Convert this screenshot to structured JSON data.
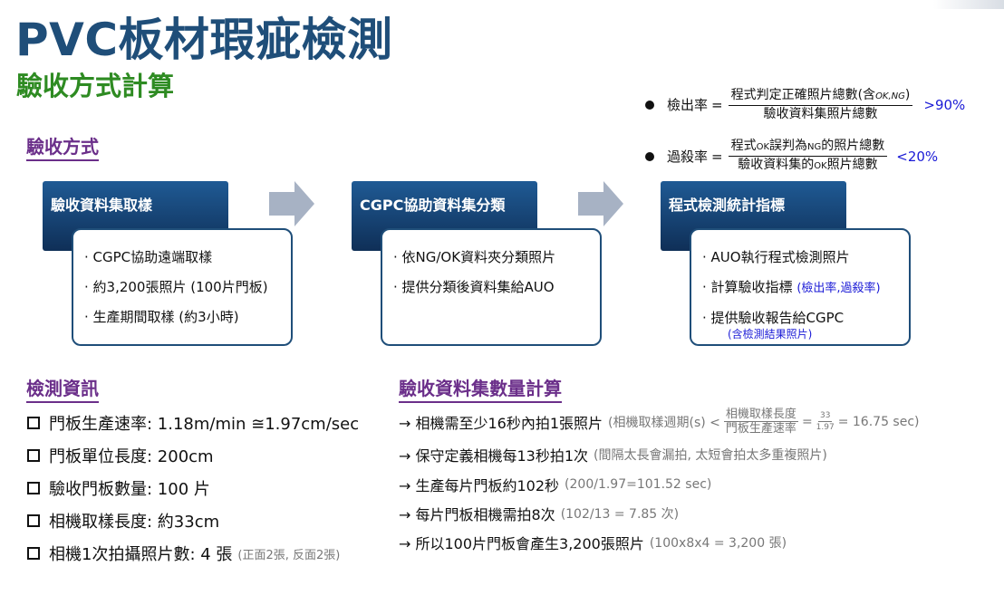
{
  "title": "PVC板材瑕疵檢測",
  "subtitle": "驗收方式計算",
  "method_heading": "驗收方式",
  "formulas": {
    "detect": {
      "label": "檢出率",
      "eq": "=",
      "numerator": "程式判定正確照片總數(含",
      "numerator_small": "OK,NG",
      "numerator_end": ")",
      "denominator": "驗收資料集照片總數",
      "target": ">90%"
    },
    "overkill": {
      "label": "過殺率",
      "eq": "=",
      "numerator_a": "程式",
      "numerator_small1": "OK",
      "numerator_b": "誤判為",
      "numerator_small2": "NG",
      "numerator_c": "的照片總數",
      "denominator_a": "驗收資料集的",
      "denominator_small": "OK",
      "denominator_b": "照片總數",
      "target": "<20%"
    }
  },
  "steps": [
    {
      "header": "驗收資料集取樣",
      "items": [
        "· CGPC協助遠端取樣",
        "· 約3,200張照片 (100片門板)",
        "· 生產期間取樣 (約3小時)"
      ]
    },
    {
      "header": "CGPC協助資料集分類",
      "items": [
        "· 依NG/OK資料夾分類照片",
        "· 提供分類後資料集給AUO"
      ]
    },
    {
      "header": "程式檢測統計指標",
      "items": [
        "· AUO執行程式檢測照片",
        "· 計算驗收指標",
        "· 提供驗收報告給CGPC"
      ],
      "item2_note": "(檢出率,過殺率)",
      "item3_note": "(含檢測結果照片)"
    }
  ],
  "info_heading": "檢測資訊",
  "info": [
    {
      "text": "門板生產速率: 1.18m/min ≅1.97cm/sec"
    },
    {
      "text": "門板單位長度: 200cm"
    },
    {
      "text": "驗收門板數量: 100 片"
    },
    {
      "text": "相機取樣長度: 約33cm"
    },
    {
      "text": "相機1次拍攝照片數: 4 張",
      "note": "(正面2張, 反面2張)"
    }
  ],
  "calc_heading": "驗收資料集數量計算",
  "calc": [
    {
      "text": "→ 相機需至少16秒內拍1張照片",
      "note_a": "(相機取樣週期(s) <",
      "frac_num": "相機取樣長度",
      "frac_den": "門板生產速率",
      "eq": "=",
      "mini_num": "33",
      "mini_den": "1.97",
      "note_b": "= 16.75 sec)"
    },
    {
      "text": "→ 保守定義相機每13秒拍1次",
      "note": "(間隔太長會漏拍, 太短會拍太多重複照片)"
    },
    {
      "text": "→ 生產每片門板約102秒",
      "note": "(200/1.97=101.52 sec)"
    },
    {
      "text": "→ 每片門板相機需拍8次",
      "note": "(102/13 = 7.85 次)"
    },
    {
      "text": "→ 所以100片門板會產生3,200張照片",
      "note": "(100x8x4 = 3,200 張)"
    }
  ],
  "colors": {
    "title": "#1f4e79",
    "subtitle": "#2e8b22",
    "section": "#6b2f8a",
    "header_box": "#1f5a94",
    "arrow": "#a7b2c4",
    "highlight": "#1a1ad6"
  }
}
